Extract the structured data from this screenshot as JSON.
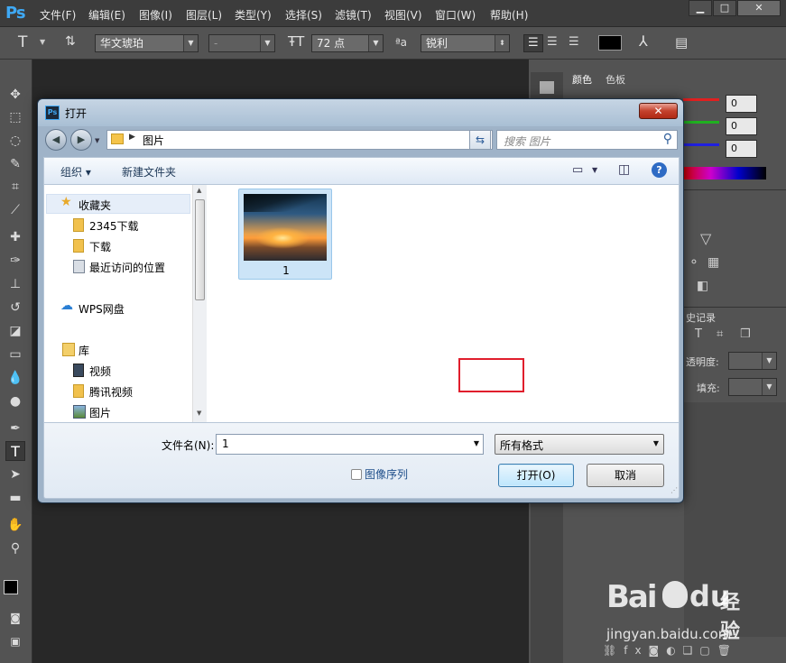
{
  "app": {
    "logo": "Ps",
    "menu": [
      "文件(F)",
      "编辑(E)",
      "图像(I)",
      "图层(L)",
      "类型(Y)",
      "选择(S)",
      "滤镜(T)",
      "视图(V)",
      "窗口(W)",
      "帮助(H)"
    ],
    "window_buttons": {
      "minimize": "▁",
      "maximize": "□",
      "close": "✕"
    }
  },
  "options_bar": {
    "tool_glyph": "T",
    "font_family": "华文琥珀",
    "font_style": "-",
    "font_size": "72 点",
    "aa_label": "ªa",
    "antialias": "锐利",
    "text_color": "#000000"
  },
  "panels": {
    "color_tabs": [
      "颜色",
      "色板"
    ],
    "rgb_values": [
      "0",
      "0",
      "0"
    ],
    "history_tab": "史记录",
    "opacity_label": "透明度:",
    "fill_label": "填充:"
  },
  "dialog": {
    "title": "打开",
    "ps_icon": "Ps",
    "close_glyph": "✕",
    "address": "图片",
    "search_placeholder": "搜索 图片",
    "toolbar": {
      "organize": "组织 ▾",
      "new_folder": "新建文件夹"
    },
    "nav": {
      "favorites": "收藏夹",
      "fav_items": [
        "2345下载",
        "下载",
        "最近访问的位置"
      ],
      "wps": "WPS网盘",
      "library": "库",
      "lib_items": [
        "视频",
        "腾讯视频",
        "图片"
      ]
    },
    "files": [
      {
        "name": "1"
      }
    ],
    "filename_label": "文件名(N):",
    "filename_value": "1",
    "filetype_value": "所有格式",
    "image_sequence": "图像序列",
    "open_button": "打开(O)",
    "cancel_button": "取消"
  },
  "colors": {
    "accent_blue": "#3fa9f5",
    "highlight_red": "#e01e2c",
    "slider_red": "#e02020",
    "slider_green": "#20b020",
    "slider_blue": "#2020e0"
  }
}
